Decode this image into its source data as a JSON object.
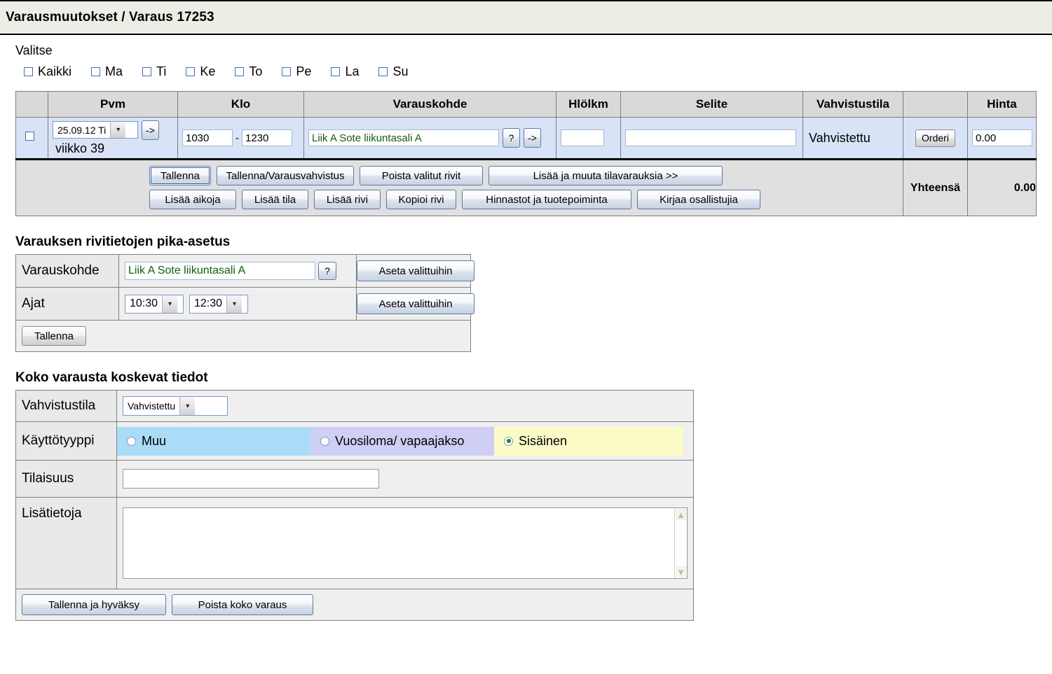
{
  "header": {
    "title": "Varausmuutokset / Varaus 17253"
  },
  "select_section": {
    "label": "Valitse",
    "days": [
      {
        "label": "Kaikki",
        "checked": false
      },
      {
        "label": "Ma",
        "checked": false
      },
      {
        "label": "Ti",
        "checked": false
      },
      {
        "label": "Ke",
        "checked": false
      },
      {
        "label": "To",
        "checked": false
      },
      {
        "label": "Pe",
        "checked": false
      },
      {
        "label": "La",
        "checked": false
      },
      {
        "label": "Su",
        "checked": false
      }
    ]
  },
  "grid": {
    "columns": [
      "",
      "Pvm",
      "Klo",
      "Varauskohde",
      "Hlölkm",
      "Selite",
      "Vahvistustila",
      "",
      "Hinta"
    ],
    "row": {
      "selected": false,
      "date_value": "25.09.12 Ti",
      "week_text": "viikko 39",
      "date_go_label": "->",
      "time_start": "1030",
      "time_separator": "-",
      "time_end": "1230",
      "resource_value": "Liik A Sote liikuntasali A",
      "resource_help_label": "?",
      "resource_go_label": "->",
      "person_count": "",
      "description": "",
      "confirm_state": "Vahvistettu",
      "order_button": "Orderi",
      "price": "0.00"
    },
    "toolbar": {
      "row1": [
        "Tallenna",
        "Tallenna/Varausvahvistus",
        "Poista valitut rivit",
        "Lisää ja muuta tilavarauksia >>"
      ],
      "row2": [
        "Lisää aikoja",
        "Lisää tila",
        "Lisää rivi",
        "Kopioi rivi",
        "Hinnastot ja tuotepoiminta",
        "Kirjaa osallistujia"
      ]
    },
    "total_label": "Yhteensä",
    "total_value": "0.00"
  },
  "quickset": {
    "heading": "Varauksen rivitietojen pika-asetus",
    "resource_label": "Varauskohde",
    "resource_value": "Liik A Sote liikuntasali A",
    "resource_help_label": "?",
    "resource_apply_label": "Aseta valittuihin",
    "times_label": "Ajat",
    "time_start": "10:30",
    "time_end": "12:30",
    "times_apply_label": "Aseta valittuihin",
    "save_label": "Tallenna"
  },
  "whole": {
    "heading": "Koko varausta koskevat tiedot",
    "confirm_label": "Vahvistustila",
    "confirm_value": "Vahvistettu",
    "usetype_label": "Käyttötyyppi",
    "usetype_options": [
      {
        "label": "Muu",
        "selected": false,
        "color": "#aadcf7"
      },
      {
        "label": "Vuosiloma/ vapaajakso",
        "selected": false,
        "color": "#cfcff5"
      },
      {
        "label": "Sisäinen",
        "selected": true,
        "color": "#fbfbc8"
      }
    ],
    "event_label": "Tilaisuus",
    "event_value": "",
    "notes_label": "Lisätietoja",
    "notes_value": "",
    "save_approve_label": "Tallenna ja hyväksy",
    "delete_label": "Poista koko varaus"
  }
}
